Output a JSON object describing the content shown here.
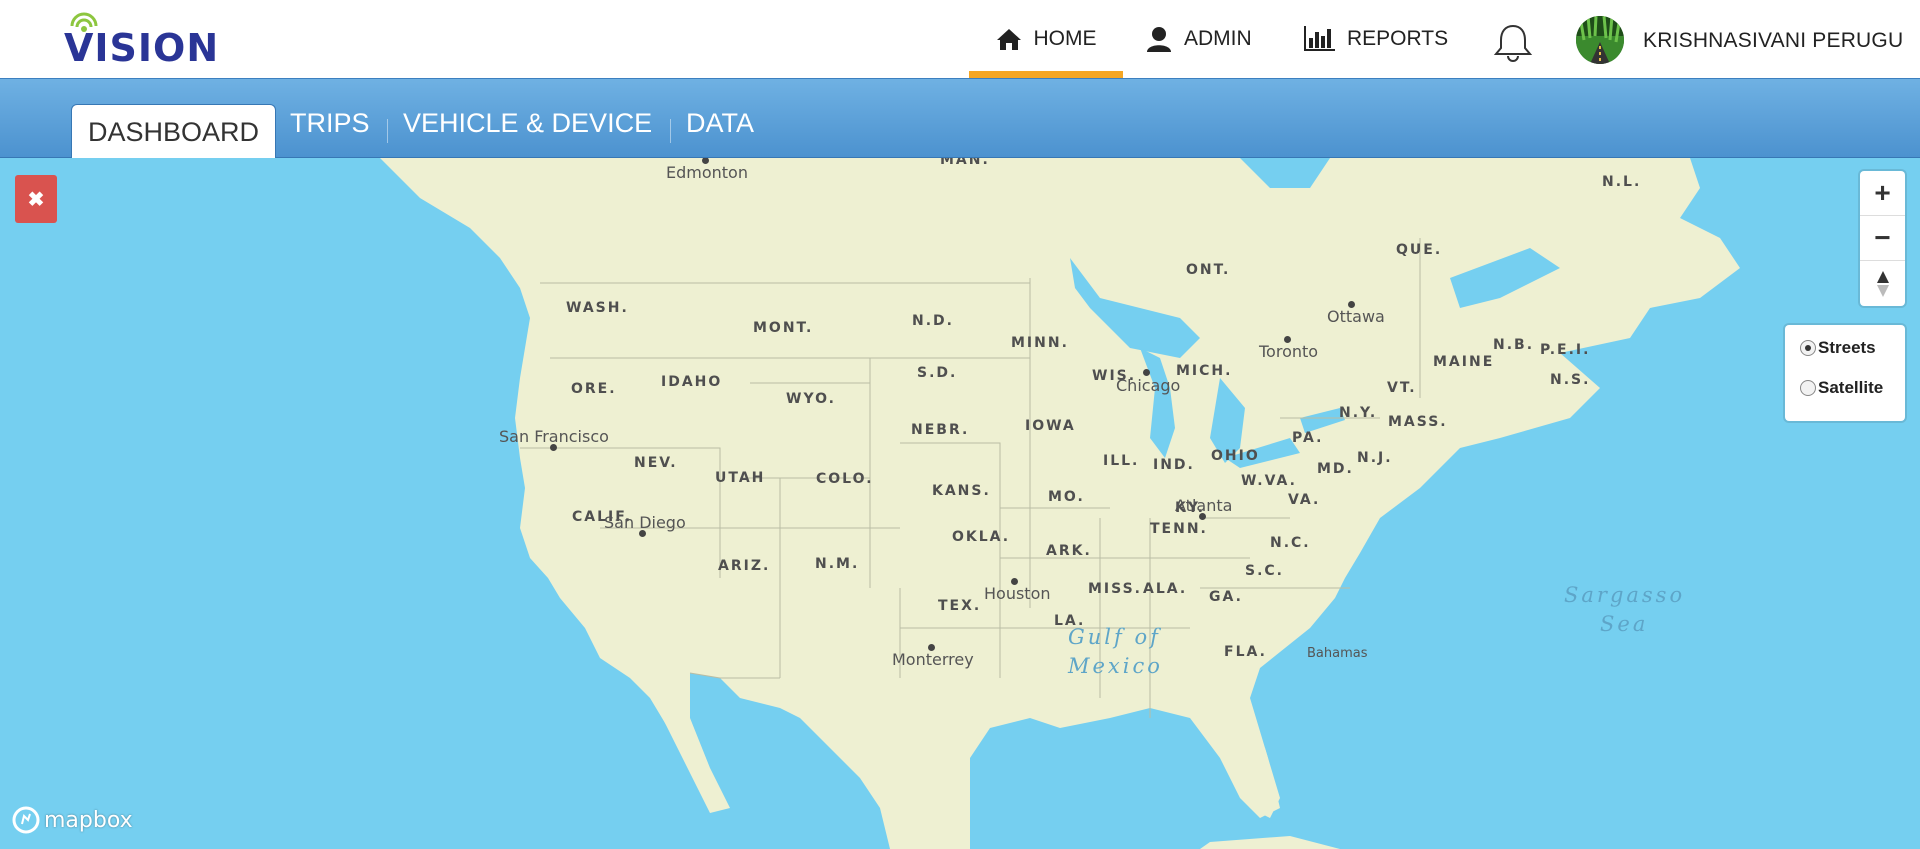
{
  "app": {
    "logo_text": "VISION",
    "brand_color": "#2a3596",
    "accent_color": "#f5a623"
  },
  "nav": {
    "home": {
      "label": "HOME",
      "icon": "home-icon",
      "active": true
    },
    "admin": {
      "label": "ADMIN",
      "icon": "user-icon"
    },
    "reports": {
      "label": "REPORTS",
      "icon": "bar-chart-icon"
    },
    "notifications_icon": "bell-icon",
    "user": {
      "name": "KRISHNASIVANI PERUGU"
    }
  },
  "tabs": [
    {
      "label": "DASHBOARD",
      "active": true
    },
    {
      "label": "TRIPS"
    },
    {
      "label": "VEHICLE & DEVICE"
    },
    {
      "label": "DATA"
    }
  ],
  "map": {
    "close_icon": "close-icon",
    "zoom_in": "+",
    "zoom_out": "−",
    "compass_icon": "compass-icon",
    "styles": [
      {
        "label": "Streets",
        "checked": true
      },
      {
        "label": "Satellite",
        "checked": false
      }
    ],
    "attribution": "mapbox",
    "labels": {
      "man": "MAN.",
      "ont": "ONT.",
      "que": "QUE.",
      "nl": "N.L.",
      "nb": "N.B.",
      "pei": "P.E.I.",
      "ns": "N.S.",
      "wash": "WASH.",
      "mont": "MONT.",
      "nd": "N.D.",
      "minn": "MINN.",
      "ore": "ORE.",
      "idaho": "IDAHO",
      "sd": "S.D.",
      "wyo": "WYO.",
      "wis": "WIS.",
      "mich": "MICH.",
      "maine": "MAINE",
      "vt": "VT.",
      "ny": "N.Y.",
      "mass": "MASS.",
      "iowa": "IOWA",
      "nebr": "NEBR.",
      "nev": "NEV.",
      "utah": "UTAH",
      "colo": "COLO.",
      "ill": "ILL.",
      "ind": "IND.",
      "ohio": "OHIO",
      "pa": "PA.",
      "nj": "N.J.",
      "md": "MD.",
      "kans": "KANS.",
      "mo": "MO.",
      "wva": "W.VA.",
      "va": "VA.",
      "ky": "KY.",
      "calif": "CALIF.",
      "okla": "OKLA.",
      "ark": "ARK.",
      "tenn": "TENN.",
      "nc": "N.C.",
      "ariz": "ARIZ.",
      "nm": "N.M.",
      "sc": "S.C.",
      "tex": "TEX.",
      "miss": "MISS.",
      "ala": "ALA.",
      "ga": "GA.",
      "la": "LA.",
      "fla": "FLA."
    },
    "cities": {
      "edmonton": "Edmonton",
      "ottawa": "Ottawa",
      "toronto": "Toronto",
      "chicago": "Chicago",
      "san_francisco": "San Francisco",
      "san_diego": "San Diego",
      "atlanta": "Atlanta",
      "houston": "Houston",
      "monterrey": "Monterrey",
      "bahamas": "Bahamas"
    },
    "water": {
      "gulf_1": "Gulf of",
      "gulf_2": "Mexico",
      "sargasso_1": "Sargasso",
      "sargasso_2": "Sea"
    }
  }
}
